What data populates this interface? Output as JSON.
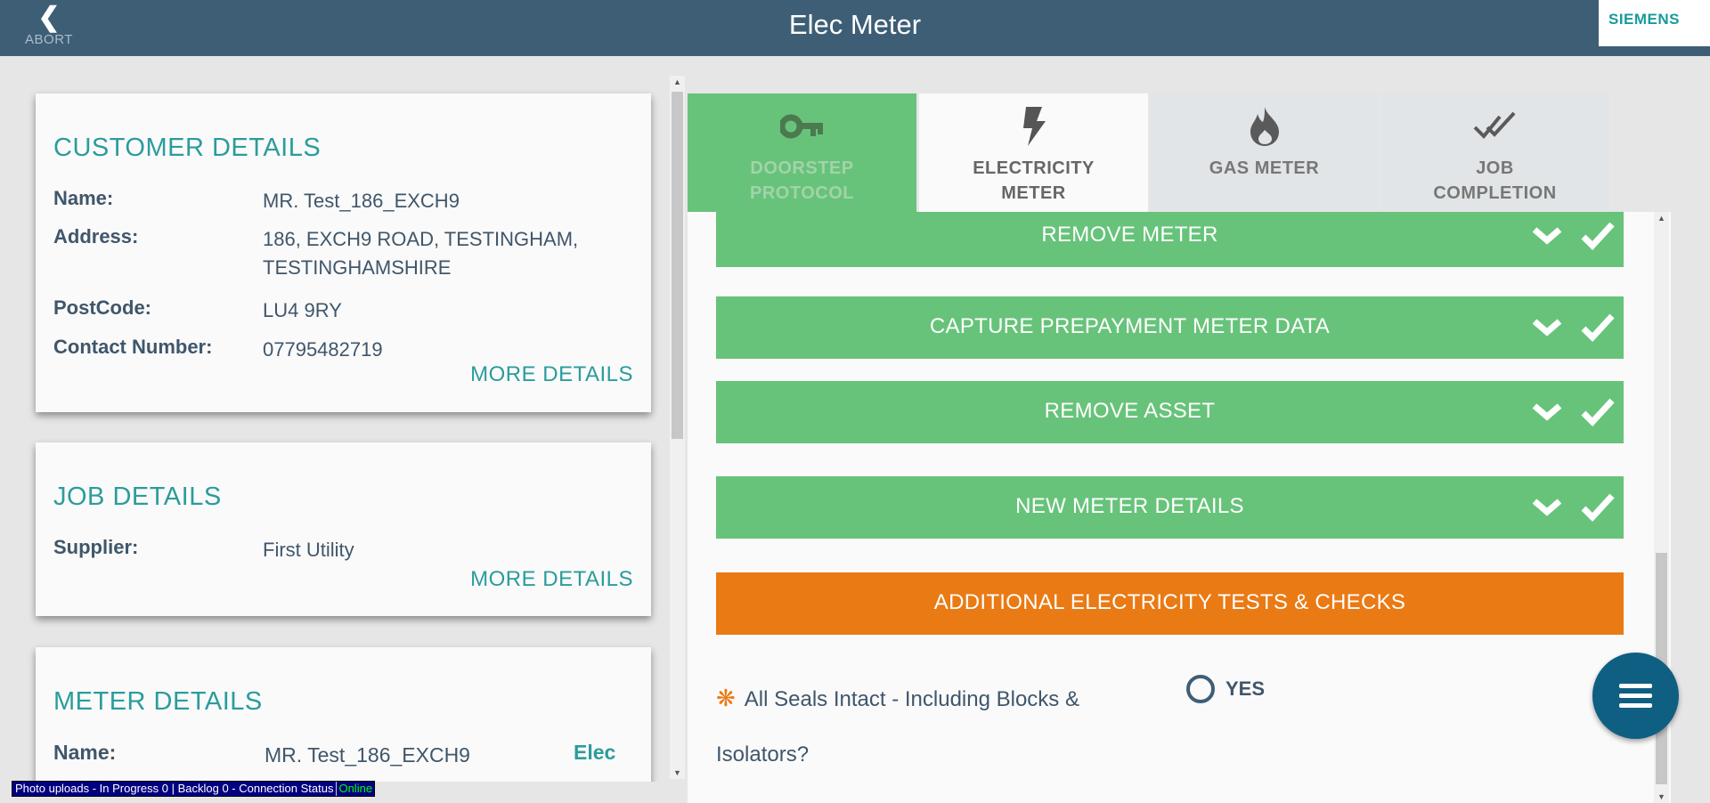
{
  "header": {
    "abort_label": "ABORT",
    "title": "Elec Meter",
    "logo_text": "SIEMENS"
  },
  "customer": {
    "heading": "CUSTOMER DETAILS",
    "name_label": "Name:",
    "name_value": "MR. Test_186_EXCH9",
    "address_label": "Address:",
    "address_value": "186, EXCH9 ROAD, TESTINGHAM, TESTINGHAMSHIRE",
    "postcode_label": "PostCode:",
    "postcode_value": "LU4 9RY",
    "contact_label": "Contact Number:",
    "contact_value": "07795482719",
    "more_label": "MORE DETAILS"
  },
  "job": {
    "heading": "JOB DETAILS",
    "supplier_label": "Supplier:",
    "supplier_value": "First Utility",
    "more_label": "MORE DETAILS"
  },
  "meter": {
    "heading": "METER DETAILS",
    "name_label": "Name:",
    "name_value": "MR. Test_186_EXCH9",
    "type_value": "Elec"
  },
  "tabs": [
    {
      "line1": "DOORSTEP",
      "line2": "PROTOCOL",
      "icon": "key-icon",
      "state": "complete"
    },
    {
      "line1": "ELECTRICITY",
      "line2": "METER",
      "icon": "lightning-icon",
      "state": "active"
    },
    {
      "line1": "GAS METER",
      "line2": "",
      "icon": "flame-icon",
      "state": "inactive"
    },
    {
      "line1": "JOB",
      "line2": "COMPLETION",
      "icon": "double-check-icon",
      "state": "inactive"
    }
  ],
  "sections": [
    {
      "label": "REMOVE METER",
      "status": "complete"
    },
    {
      "label": "CAPTURE PREPAYMENT METER DATA",
      "status": "complete"
    },
    {
      "label": "REMOVE ASSET",
      "status": "complete"
    },
    {
      "label": "NEW METER DETAILS",
      "status": "complete"
    },
    {
      "label": "ADDITIONAL ELECTRICITY TESTS & CHECKS",
      "status": "in-progress"
    }
  ],
  "question": {
    "text": "All Seals Intact - Including Blocks & Isolators?",
    "required_marker": "❋",
    "option_yes": "YES"
  },
  "status_bar": {
    "text": "Photo uploads - In Progress 0 | Backlog 0 - Connection Status",
    "connection": "Online"
  },
  "colors": {
    "header": "#3e5e76",
    "accent_teal": "#2b9c9c",
    "complete_green": "#67c37a",
    "in_progress_orange": "#ea7a14",
    "fab_blue": "#0f5f82"
  }
}
